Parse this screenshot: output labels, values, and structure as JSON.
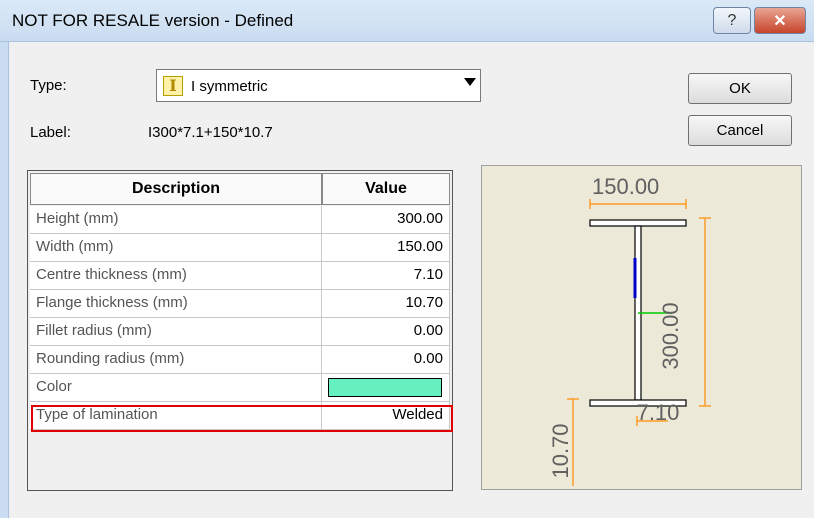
{
  "window": {
    "title": "NOT FOR RESALE version - Defined",
    "help_glyph": "?",
    "close_glyph": "✕"
  },
  "form": {
    "type_label": "Type:",
    "type_value": "I symmetric",
    "type_icon": "I",
    "label_label": "Label:",
    "label_value": "I300*7.1+150*10.7"
  },
  "buttons": {
    "ok": "OK",
    "cancel": "Cancel"
  },
  "table": {
    "headers": {
      "description": "Description",
      "value": "Value"
    },
    "rows": [
      {
        "description": "Height (mm)",
        "value": "300.00"
      },
      {
        "description": "Width (mm)",
        "value": "150.00"
      },
      {
        "description": "Centre thickness (mm)",
        "value": "7.10"
      },
      {
        "description": "Flange thickness (mm)",
        "value": "10.70"
      },
      {
        "description": "Fillet radius (mm)",
        "value": "0.00"
      },
      {
        "description": "Rounding radius (mm)",
        "value": "0.00"
      },
      {
        "description": "Color",
        "value": ""
      },
      {
        "description": "Type of lamination",
        "value": "Welded"
      }
    ],
    "color_swatch": "#66f0c0",
    "highlighted_row": "Type of lamination"
  },
  "preview": {
    "width_dim": "150.00",
    "height_dim": "300.00",
    "web_dim": "7.10",
    "flange_dim": "10.70",
    "dim_color": "#ff8c00",
    "text_color": "#606060"
  }
}
